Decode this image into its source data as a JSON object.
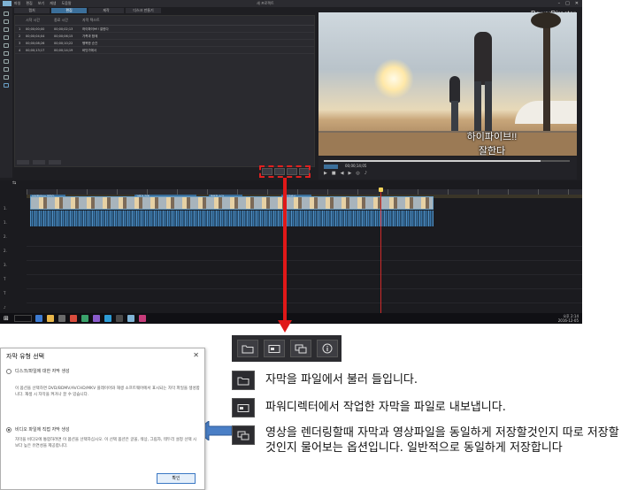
{
  "app": {
    "brand": "PowerDirector",
    "menu_items": [
      "파일",
      "편집",
      "보기",
      "재생",
      "도움말"
    ],
    "project_title": "새 프로젝트",
    "room_tabs": [
      "캡처",
      "편집",
      "제작",
      "디스크 만들기"
    ],
    "subtitle_columns": [
      "",
      "시작 시간",
      "종료 시간",
      "자막 텍스트"
    ],
    "subtitle_rows": [
      {
        "index": "1",
        "start": "00;00;00;00",
        "end": "00;00;02;13",
        "text": "하이파이브!! 잘한다"
      },
      {
        "index": "2",
        "start": "00;00;04;04",
        "end": "00;00;06;15",
        "text": "가족과 함께"
      },
      {
        "index": "3",
        "start": "00;00;08;26",
        "end": "00;00;10;22",
        "text": "행복한 순간"
      },
      {
        "index": "4",
        "start": "00;00;13;17",
        "end": "00;00;14;19",
        "text": "바닷가에서"
      }
    ],
    "captions": [
      "하이파이브!!",
      "잘한다"
    ],
    "timecode": "00;00;14;05",
    "playback_progress": 0.88,
    "markers": [
      "하이파이브!! 잘한다",
      "가족과 함께",
      "행복한 순간",
      "바닷가에서"
    ],
    "track_labels": [
      "1.",
      "1.",
      "2.",
      "2.",
      "3.",
      "T",
      "T",
      "♪"
    ],
    "tray_time": "오후 2:14",
    "tray_date": "2016-12-05"
  },
  "closeup_icons": [
    "folder-icon",
    "export-subtitle-icon",
    "render-subtitle-icon",
    "info-icon"
  ],
  "legend": [
    {
      "icon": "folder-icon",
      "text": "자막을 파일에서 불러 들입니다."
    },
    {
      "icon": "export-subtitle-icon",
      "text": "파워디렉터에서 작업한 자막을 파일로 내보냅니다."
    },
    {
      "icon": "render-subtitle-icon",
      "text": "영상을 렌더링할때 자막과 영상파일을 동일하게 저장할것인지 따로 저장할 것인지 물어보는 옵션입니다. 일반적으로 동일하게 저장합니다"
    }
  ],
  "dialog": {
    "title": "자막 유형 선택",
    "close": "✕",
    "option_1": "디스크/파일에 대한 자막 생성",
    "desc_1": "이 옵션을 선택하면 DVD/BDMV/AVCHD/MKV 플레이어와 재생 소프트웨어에서 표시되는 자막 파일을 생성합니다. 재생 시 자막을 켜거나 끌 수 있습니다.",
    "option_2": "비디오 파일에 직접 자막 생성",
    "desc_2": "자막을 비디오에 통합하려면 이 옵션을 선택하십시오. 이 선택 옵션은 글꼴, 색상, 그림자, 테두리 설정 선택 시 보다 높은 유연성을 제공합니다.",
    "ok_label": "확인"
  },
  "colors": {
    "accent": "#3b6f9a",
    "highlight": "#e01818",
    "arrow": "#4a7fc6"
  }
}
